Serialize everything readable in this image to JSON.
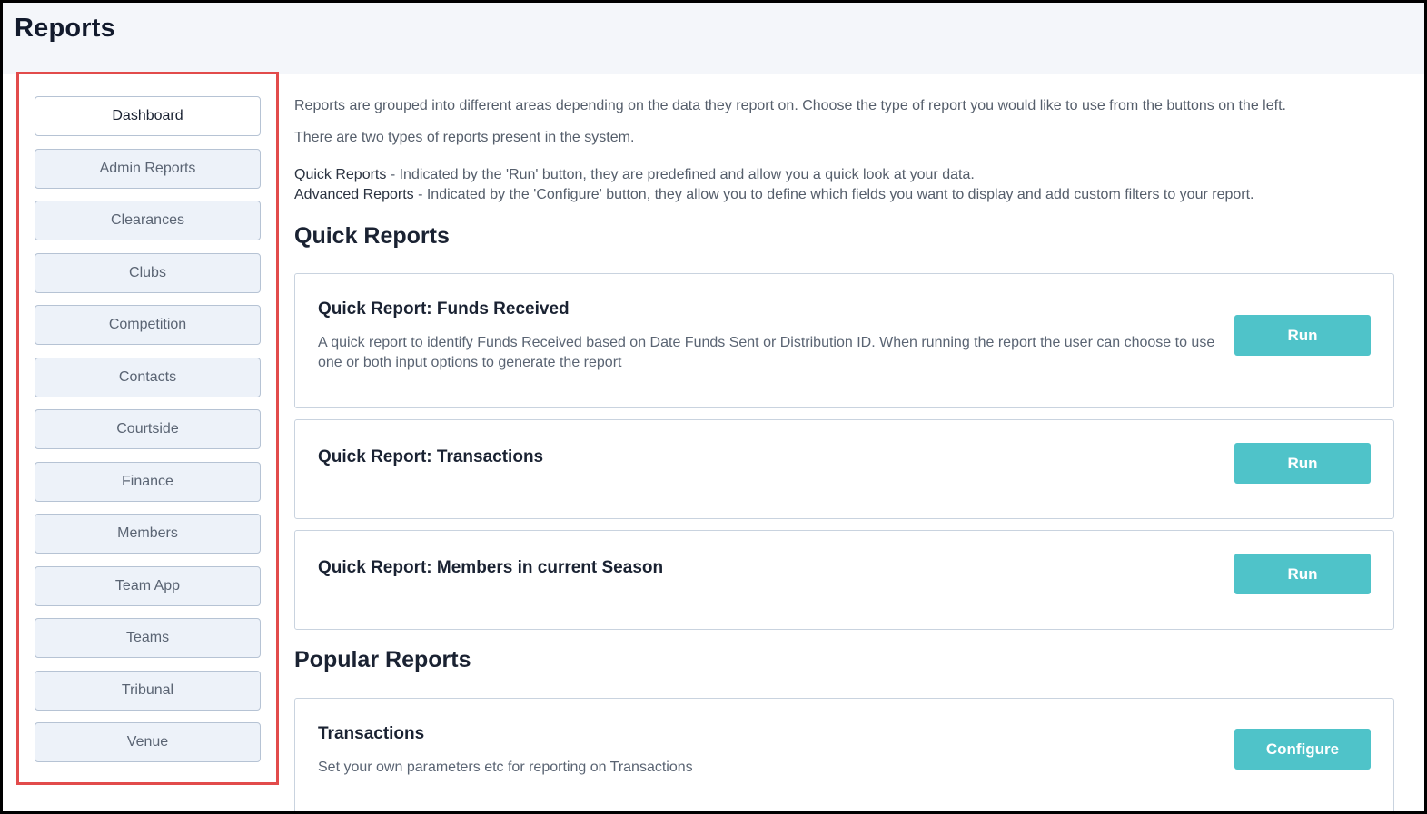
{
  "page": {
    "title": "Reports"
  },
  "sidebar": {
    "items": [
      {
        "label": "Dashboard"
      },
      {
        "label": "Admin Reports"
      },
      {
        "label": "Clearances"
      },
      {
        "label": "Clubs"
      },
      {
        "label": "Competition"
      },
      {
        "label": "Contacts"
      },
      {
        "label": "Courtside"
      },
      {
        "label": "Finance"
      },
      {
        "label": "Members"
      },
      {
        "label": "Team App"
      },
      {
        "label": "Teams"
      },
      {
        "label": "Tribunal"
      },
      {
        "label": "Venue"
      }
    ],
    "active_item": "Dashboard",
    "highlight_color": "#e24b4b"
  },
  "intro": {
    "line1": "Reports are grouped into different areas depending on the data they report on. Choose the type of report you would like to use from the buttons on the left.",
    "line2": "There are two types of reports present in the system.",
    "quick_term": "Quick Reports",
    "quick_desc": " - Indicated by the 'Run' button, they are predefined and allow you a quick look at your data.",
    "advanced_term": "Advanced Reports",
    "advanced_desc": " - Indicated by the 'Configure' button, they allow you to define which fields you want to display and add custom filters to your report."
  },
  "quick_reports": {
    "heading": "Quick Reports",
    "items": [
      {
        "title": "Quick Report: Funds Received",
        "description": "A quick report to identify Funds Received based on Date Funds Sent or Distribution ID. When running the report the user can choose to use one or both input options to generate the report",
        "button": "Run"
      },
      {
        "title": "Quick Report: Transactions",
        "description": "",
        "button": "Run"
      },
      {
        "title": "Quick Report: Members in current Season",
        "description": "",
        "button": "Run"
      }
    ]
  },
  "popular_reports": {
    "heading": "Popular Reports",
    "items": [
      {
        "title": "Transactions",
        "description": "Set your own parameters etc for reporting on Transactions",
        "button": "Configure"
      }
    ]
  },
  "colors": {
    "accent": "#4fc3c9",
    "header_bg": "#f4f6fa",
    "sidebar_button_bg": "#edf2f9"
  }
}
